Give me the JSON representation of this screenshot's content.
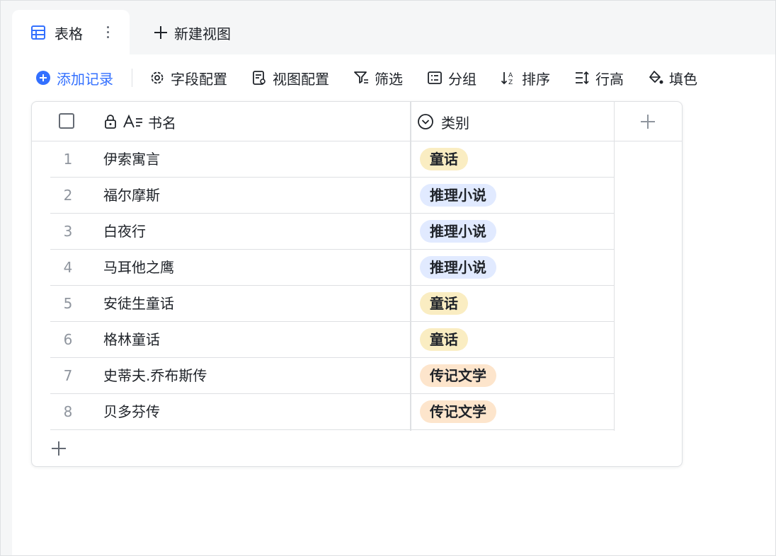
{
  "tabs": {
    "active_label": "表格",
    "new_view_label": "新建视图"
  },
  "toolbar": {
    "add_record": "添加记录",
    "field_config": "字段配置",
    "view_config": "视图配置",
    "filter": "筛选",
    "group": "分组",
    "sort": "排序",
    "row_height": "行高",
    "fill_color": "填色"
  },
  "table": {
    "columns": {
      "name": "书名",
      "category": "类别"
    },
    "rows": [
      {
        "num": "1",
        "name": "伊索寓言",
        "category": "童话"
      },
      {
        "num": "2",
        "name": "福尔摩斯",
        "category": "推理小说"
      },
      {
        "num": "3",
        "name": "白夜行",
        "category": "推理小说"
      },
      {
        "num": "4",
        "name": "马耳他之鹰",
        "category": "推理小说"
      },
      {
        "num": "5",
        "name": "安徒生童话",
        "category": "童话"
      },
      {
        "num": "6",
        "name": "格林童话",
        "category": "童话"
      },
      {
        "num": "7",
        "name": "史蒂夫.乔布斯传",
        "category": "传记文学"
      },
      {
        "num": "8",
        "name": "贝多芬传",
        "category": "传记文学"
      }
    ]
  },
  "colors": {
    "accent": "#3370ff",
    "tag_fairy_tale": "#faedc2",
    "tag_detective": "#e1eaff",
    "tag_biography": "#fde5cc"
  }
}
